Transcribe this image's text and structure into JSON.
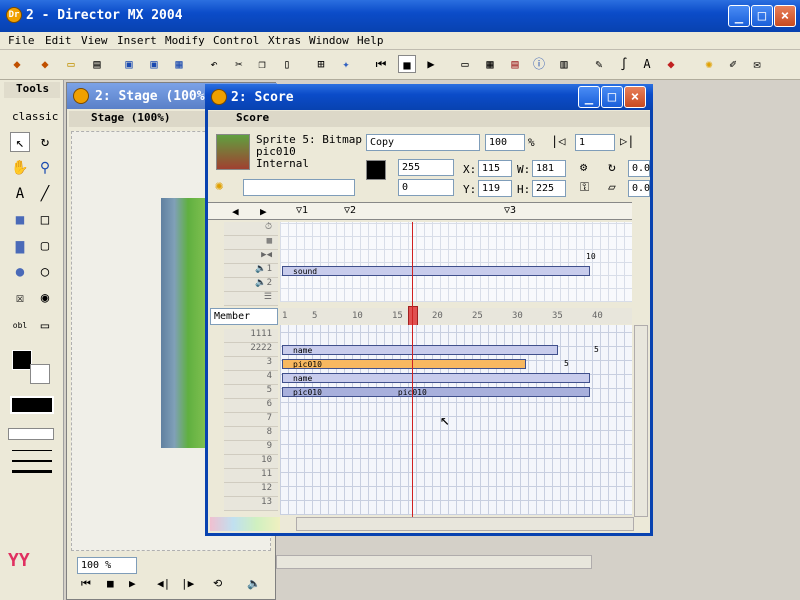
{
  "app": {
    "title": "2 - Director MX 2004",
    "logo": "Dr"
  },
  "menu": [
    "File",
    "Edit",
    "View",
    "Insert",
    "Modify",
    "Control",
    "Xtras",
    "Window",
    "Help"
  ],
  "tools": {
    "title": "Tools",
    "mode": "classic"
  },
  "stage": {
    "title": "2: Stage (100%)",
    "panel": "Stage (100%)",
    "zoom": "100 %"
  },
  "score": {
    "title": "2: Score",
    "panel": "Score",
    "sprite": {
      "name": "Sprite 5: Bitmap",
      "member": "pic010",
      "cast": "Internal"
    },
    "ink": "Copy",
    "blend": "100",
    "blend_unit": "%",
    "start_frame": "1",
    "fg": "255",
    "bg": "0",
    "x": "115",
    "y": "119",
    "w": "181",
    "h": "225",
    "rot": "0.0",
    "skew": "0.0",
    "x_label": "X:",
    "y_label": "Y:",
    "w_label": "W:",
    "h_label": "H:",
    "markers": [
      "1",
      "2",
      "3"
    ],
    "effect_channels": [
      "",
      "",
      "",
      "1",
      "2",
      ""
    ],
    "display": "Member",
    "ruler": [
      "1",
      "5",
      "10",
      "15",
      "20",
      "25",
      "30",
      "35",
      "40"
    ],
    "channels": [
      "1111",
      "2222",
      "3",
      "4",
      "5",
      "6",
      "7",
      "8",
      "9",
      "10",
      "11",
      "12",
      "13"
    ],
    "bars": [
      {
        "label": "name",
        "end": "5"
      },
      {
        "label": "pic010",
        "end": "5"
      },
      {
        "label": "name"
      },
      {
        "label": "pic010",
        "label2": "pic010"
      }
    ],
    "sound_label": "sound",
    "sound_end": "10"
  },
  "colors": {
    "titlebar": "#0842b0",
    "bar_blue": "#b8c0ec",
    "bar_orange": "#f8b860",
    "playhead": "#d02020"
  }
}
